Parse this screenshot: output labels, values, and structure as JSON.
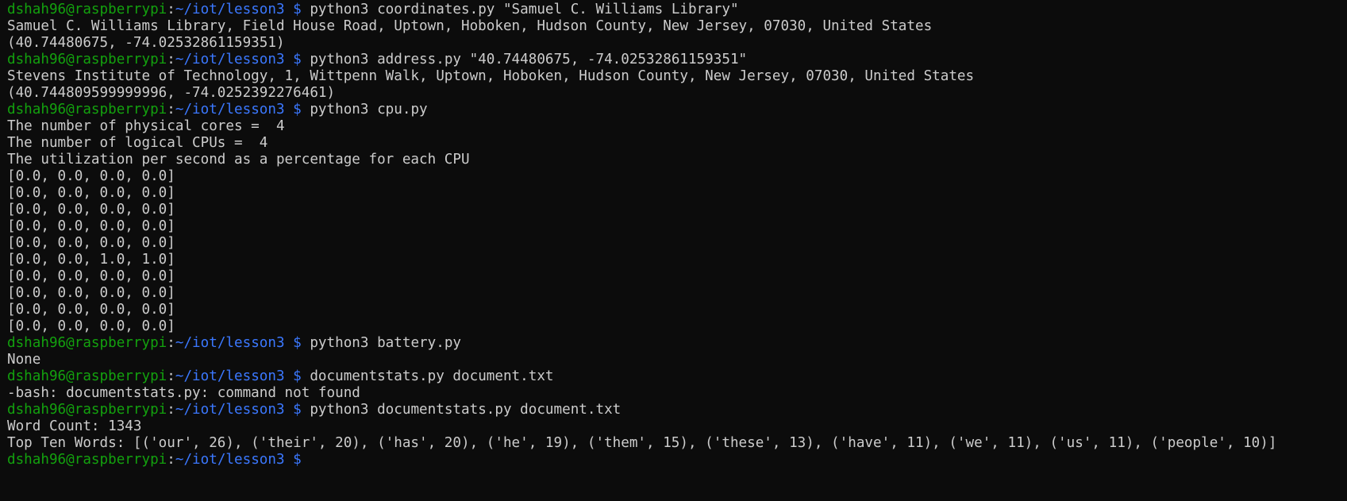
{
  "prompt": {
    "user_host": "dshah96@raspberrypi",
    "colon": ":",
    "path": "~/iot/lesson3",
    "dollar": " $ "
  },
  "lines": [
    {
      "type": "prompt",
      "command": "python3 coordinates.py \"Samuel C. Williams Library\""
    },
    {
      "type": "output",
      "text": "Samuel C. Williams Library, Field House Road, Uptown, Hoboken, Hudson County, New Jersey, 07030, United States"
    },
    {
      "type": "output",
      "text": "(40.74480675, -74.02532861159351)"
    },
    {
      "type": "prompt",
      "command": "python3 address.py \"40.74480675, -74.02532861159351\""
    },
    {
      "type": "output",
      "text": "Stevens Institute of Technology, 1, Wittpenn Walk, Uptown, Hoboken, Hudson County, New Jersey, 07030, United States"
    },
    {
      "type": "output",
      "text": "(40.744809599999996, -74.0252392276461)"
    },
    {
      "type": "prompt",
      "command": "python3 cpu.py"
    },
    {
      "type": "output",
      "text": "The number of physical cores =  4"
    },
    {
      "type": "output",
      "text": "The number of logical CPUs =  4"
    },
    {
      "type": "output",
      "text": "The utilization per second as a percentage for each CPU"
    },
    {
      "type": "output",
      "text": "[0.0, 0.0, 0.0, 0.0]"
    },
    {
      "type": "output",
      "text": "[0.0, 0.0, 0.0, 0.0]"
    },
    {
      "type": "output",
      "text": "[0.0, 0.0, 0.0, 0.0]"
    },
    {
      "type": "output",
      "text": "[0.0, 0.0, 0.0, 0.0]"
    },
    {
      "type": "output",
      "text": "[0.0, 0.0, 0.0, 0.0]"
    },
    {
      "type": "output",
      "text": "[0.0, 0.0, 1.0, 1.0]"
    },
    {
      "type": "output",
      "text": "[0.0, 0.0, 0.0, 0.0]"
    },
    {
      "type": "output",
      "text": "[0.0, 0.0, 0.0, 0.0]"
    },
    {
      "type": "output",
      "text": "[0.0, 0.0, 0.0, 0.0]"
    },
    {
      "type": "output",
      "text": "[0.0, 0.0, 0.0, 0.0]"
    },
    {
      "type": "prompt",
      "command": "python3 battery.py"
    },
    {
      "type": "output",
      "text": "None"
    },
    {
      "type": "prompt",
      "command": "documentstats.py document.txt"
    },
    {
      "type": "output",
      "text": "-bash: documentstats.py: command not found"
    },
    {
      "type": "prompt",
      "command": "python3 documentstats.py document.txt"
    },
    {
      "type": "output",
      "text": "Word Count: 1343"
    },
    {
      "type": "output",
      "text": "Top Ten Words: [('our', 26), ('their', 20), ('has', 20), ('he', 19), ('them', 15), ('these', 13), ('have', 11), ('we', 11), ('us', 11), ('people', 10)]"
    },
    {
      "type": "prompt",
      "command": ""
    }
  ],
  "colors": {
    "background": "#0c0c0c",
    "text": "#cccccc",
    "user_host": "#13a10e",
    "path": "#3b78ff"
  }
}
